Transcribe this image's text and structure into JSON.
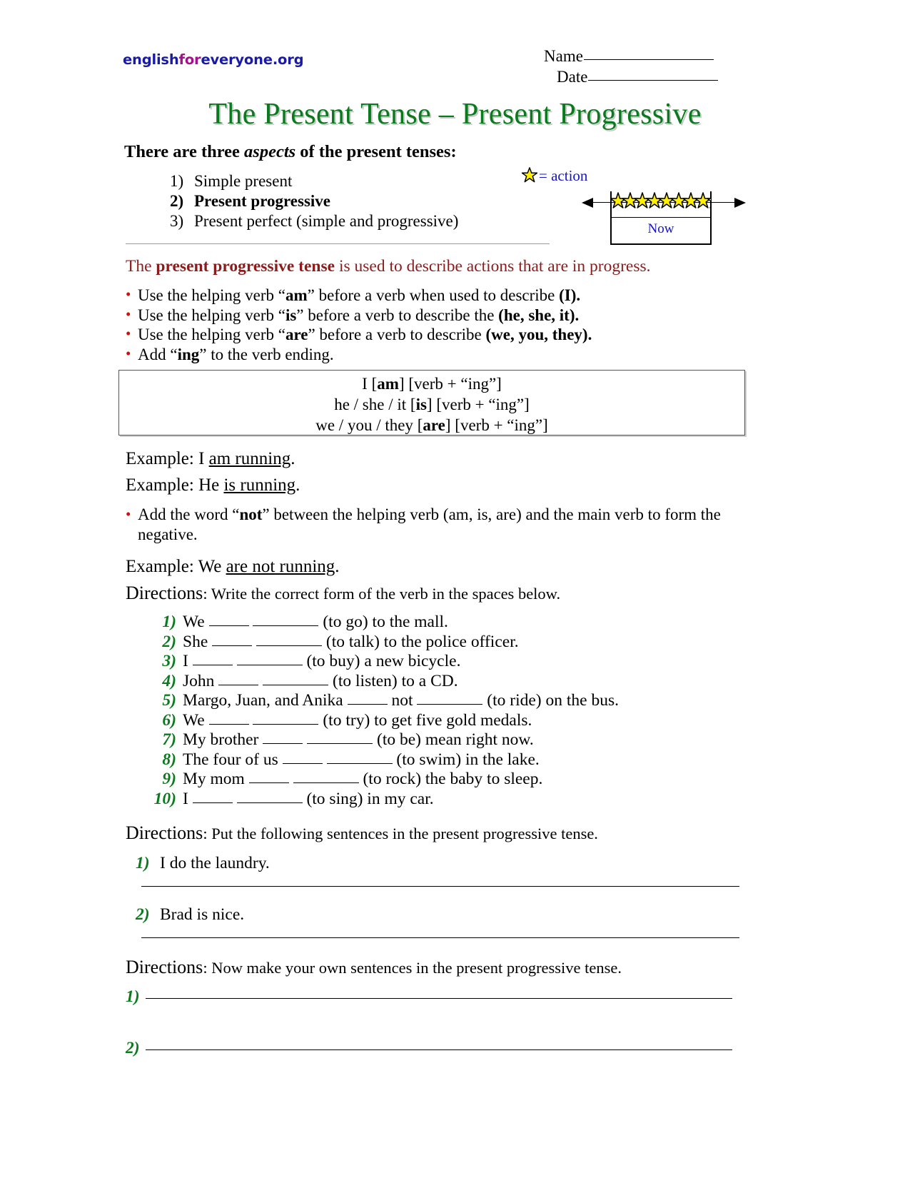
{
  "header": {
    "logo": {
      "part1": "english",
      "part2": "for",
      "part3": "everyone.org"
    },
    "name_label": "Name",
    "date_label": "Date"
  },
  "title": "The Present Tense – Present Progressive",
  "intro": {
    "heading_before": "There are three ",
    "heading_italic": "aspects",
    "heading_after": " of the present tenses:",
    "aspects": [
      {
        "num": "1)",
        "label": "Simple present",
        "bold": false
      },
      {
        "num": "2)",
        "label": "Present progressive",
        "bold": true
      },
      {
        "num": "3)",
        "label": "Present perfect (simple and progressive)",
        "bold": false
      }
    ]
  },
  "legend": {
    "equals_action": "= action",
    "star_icon": "star-icon"
  },
  "timeline": {
    "now_label": "Now",
    "star_count": 9
  },
  "rule_statement": {
    "before": "The ",
    "bold": "present progressive tense",
    "after": " is used to describe actions that are in progress."
  },
  "bullets": [
    {
      "p1": "Use the helping verb “",
      "b1": "am",
      "p2": "” before a verb when used to describe ",
      "b2": "(I)."
    },
    {
      "p1": "Use the helping verb “",
      "b1": "is",
      "p2": "” before a verb to describe the ",
      "b2": "(he, she, it)."
    },
    {
      "p1": "Use the helping verb “",
      "b1": "are",
      "p2": "” before a verb to describe ",
      "b2": "(we, you, they)."
    },
    {
      "p1": "Add “",
      "b1": "ing",
      "p2": "” to the verb ending.",
      "b2": ""
    }
  ],
  "conjugation_box": {
    "lines": [
      {
        "subject": "I",
        "aux": "am",
        "rest": "[verb + “ing”]"
      },
      {
        "subject": "he / she / it",
        "aux": "is",
        "rest": "[verb + “ing”]"
      },
      {
        "subject": "we / you / they",
        "aux": "are",
        "rest": "[verb + “ing”]"
      }
    ]
  },
  "examples": [
    {
      "label": "Example: ",
      "pre": "I ",
      "underlined": "am running",
      "post": "."
    },
    {
      "label": "Example: ",
      "pre": "He ",
      "underlined": "is running",
      "post": "."
    },
    {
      "label": "Example: ",
      "pre": "We ",
      "underlined": "are not running",
      "post": "."
    }
  ],
  "negative_bullet": {
    "p1": "Add the word “",
    "b1": "not",
    "p2": "” between the helping verb (am, is, are) and the main verb to form the negative."
  },
  "directions": {
    "one": {
      "word": "Directions",
      "text": ": Write the correct form of the verb in the spaces below."
    },
    "two": {
      "word": "Directions",
      "text": ": Put the following sentences in the present progressive tense."
    },
    "three": {
      "word": "Directions",
      "text": ": Now make your own sentences in the present progressive tense."
    }
  },
  "exercise_fill": [
    {
      "num": "1)",
      "pre": "We ",
      "mid": " ",
      "post": " (to go) to the mall."
    },
    {
      "num": "2)",
      "pre": "She ",
      "mid": " ",
      "post": " (to talk) to the police officer."
    },
    {
      "num": "3)",
      "pre": "I ",
      "mid": " ",
      "post": " (to buy) a new bicycle."
    },
    {
      "num": "4)",
      "pre": "John ",
      "mid": " ",
      "post": " (to listen) to a CD."
    },
    {
      "num": "5)",
      "pre": "Margo, Juan, and Anika ",
      "mid": " not ",
      "post": " (to ride) on the bus."
    },
    {
      "num": "6)",
      "pre": "We ",
      "mid": " ",
      "post": " (to try) to get five gold medals."
    },
    {
      "num": "7)",
      "pre": "My brother ",
      "mid": " ",
      "post": " (to be) mean right now."
    },
    {
      "num": "8)",
      "pre": "The four of us ",
      "mid": " ",
      "post": " (to swim) in the lake."
    },
    {
      "num": "9)",
      "pre": "My mom ",
      "mid": " ",
      "post": " (to rock) the baby to sleep."
    },
    {
      "num": "10)",
      "pre": "I ",
      "mid": " ",
      "post": " (to sing) in my car."
    }
  ],
  "exercise_rewrite": [
    {
      "num": "1)",
      "sentence": "I do the laundry."
    },
    {
      "num": "2)",
      "sentence": "Brad is nice."
    }
  ],
  "exercise_own": [
    {
      "num": "1)"
    },
    {
      "num": "2)"
    }
  ],
  "colors": {
    "title_green": "#0b7a1e",
    "logo_blue": "#1a1aa8",
    "logo_magenta": "#a5108c",
    "rule_maroon": "#8c1c1c",
    "bullet_red": "#cc1111",
    "legend_blue": "#1414cc",
    "star_yellow": "#ffef00"
  }
}
